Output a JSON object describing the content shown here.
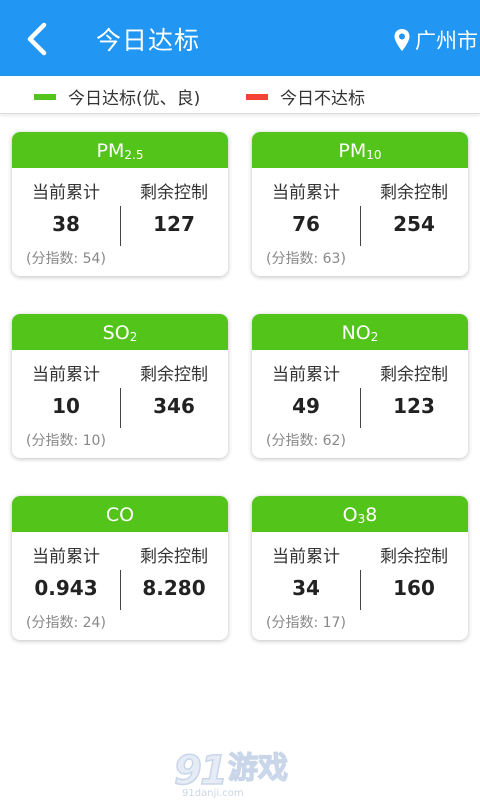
{
  "header": {
    "title": "今日达标",
    "location": "广州市"
  },
  "legend": {
    "good_label": "今日达标(优、良)",
    "good_color": "#52c41a",
    "bad_label": "今日不达标",
    "bad_color": "#f44336"
  },
  "labels": {
    "current": "当前累计",
    "remaining": "剩余控制"
  },
  "cards": [
    {
      "name_main": "PM",
      "name_sub": "2.5",
      "name_suffix": "",
      "current": "38",
      "remaining": "127",
      "sub_index": "(分指数: 54)"
    },
    {
      "name_main": "PM",
      "name_sub": "10",
      "name_suffix": "",
      "current": "76",
      "remaining": "254",
      "sub_index": "(分指数: 63)"
    },
    {
      "name_main": "SO",
      "name_sub": "2",
      "name_suffix": "",
      "current": "10",
      "remaining": "346",
      "sub_index": "(分指数: 10)"
    },
    {
      "name_main": "NO",
      "name_sub": "2",
      "name_suffix": "",
      "current": "49",
      "remaining": "123",
      "sub_index": "(分指数: 62)"
    },
    {
      "name_main": "CO",
      "name_sub": "",
      "name_suffix": "",
      "current": "0.943",
      "remaining": "8.280",
      "sub_index": "(分指数: 24)"
    },
    {
      "name_main": "O",
      "name_sub": "3",
      "name_suffix": "8",
      "current": "34",
      "remaining": "160",
      "sub_index": "(分指数: 17)"
    }
  ],
  "watermark": {
    "logo": "91游戏",
    "url": "91danji.com"
  },
  "colors": {
    "header_bg": "#2196f3",
    "card_header_bg": "#52c41a"
  }
}
